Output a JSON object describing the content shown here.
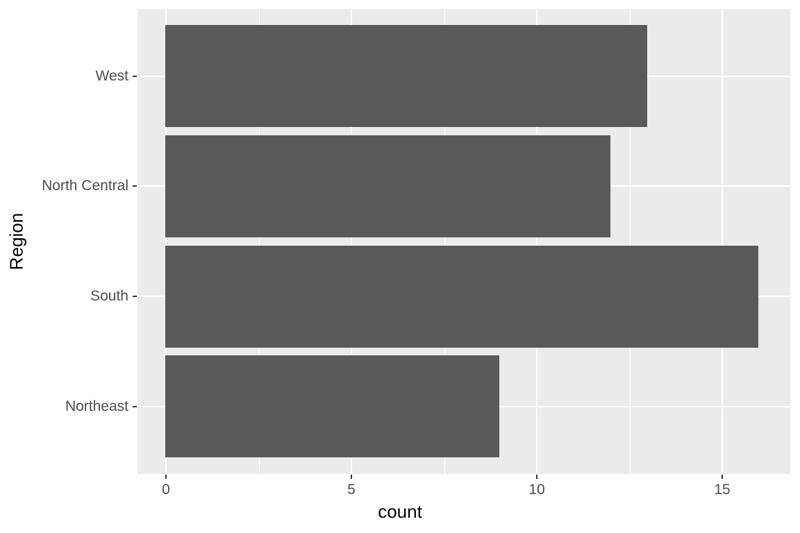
{
  "chart_data": {
    "type": "bar",
    "orientation": "horizontal",
    "title": "",
    "xlabel": "count",
    "ylabel": "Region",
    "categories": [
      "Northeast",
      "South",
      "North Central",
      "West"
    ],
    "values": [
      9,
      16,
      12,
      13
    ],
    "x_ticks": [
      0,
      5,
      10,
      15
    ],
    "x_tick_labels": [
      "0",
      "5",
      "10",
      "15"
    ],
    "x_minor_ticks": [
      2.5,
      7.5,
      12.5
    ],
    "xlim": [
      -0.8,
      16.8
    ],
    "grid": true,
    "legend": "none",
    "bar_color": "#595959",
    "panel_background": "#EBEBEB",
    "gridline_color": "#FFFFFF",
    "axis_text_color": "#4D4D4D",
    "axis_title_color": "#000000"
  },
  "axis": {
    "x_title": "count",
    "y_title": "Region",
    "x_tick_labels": [
      "0",
      "5",
      "10",
      "15"
    ],
    "y_tick_labels": [
      "West",
      "North Central",
      "South",
      "Northeast"
    ]
  }
}
